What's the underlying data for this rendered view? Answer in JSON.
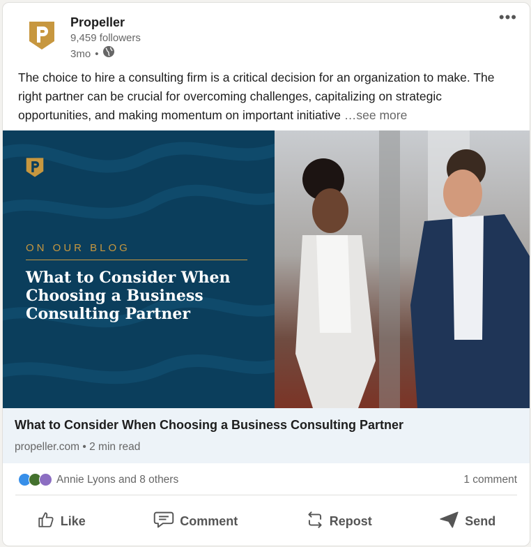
{
  "post": {
    "author": "Propeller",
    "followers": "9,459 followers",
    "age": "3mo",
    "visibility_icon": "globe-icon",
    "text": "The choice to hire a consulting firm is a critical decision for an organization to make. The right partner can be crucial for overcoming challenges, capitalizing on strategic opportunities, and making momentum on important initiative",
    "see_more": "…see more",
    "more_menu": "•••"
  },
  "banner": {
    "kicker": "ON OUR BLOG",
    "title": "What to Consider When Choosing a Business Consulting Partner",
    "left_color": "#0b3e5c",
    "accent_color": "#c7973f"
  },
  "link": {
    "title": "What to Consider When Choosing a Business Consulting Partner",
    "source": "propeller.com",
    "separator": "•",
    "read_time": "2 min read"
  },
  "social": {
    "reactors": "Annie Lyons and 8 others",
    "comments": "1 comment"
  },
  "actions": {
    "like": "Like",
    "comment": "Comment",
    "repost": "Repost",
    "send": "Send"
  }
}
